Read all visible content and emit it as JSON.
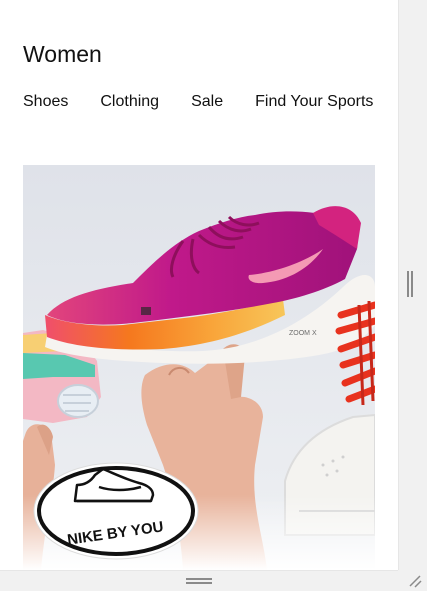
{
  "page": {
    "title": "Women"
  },
  "nav": {
    "items": [
      "Shoes",
      "Clothing",
      "Sale",
      "Find Your Sports"
    ]
  },
  "hero": {
    "badge_text": "NIKE BY YOU",
    "shoe_text": "ZOOM X"
  },
  "colors": {
    "shoe_magenta": "#b0157e",
    "sole_orange": "#f5781e",
    "background": "#e4e7ed",
    "laces_red": "#e8321e"
  }
}
